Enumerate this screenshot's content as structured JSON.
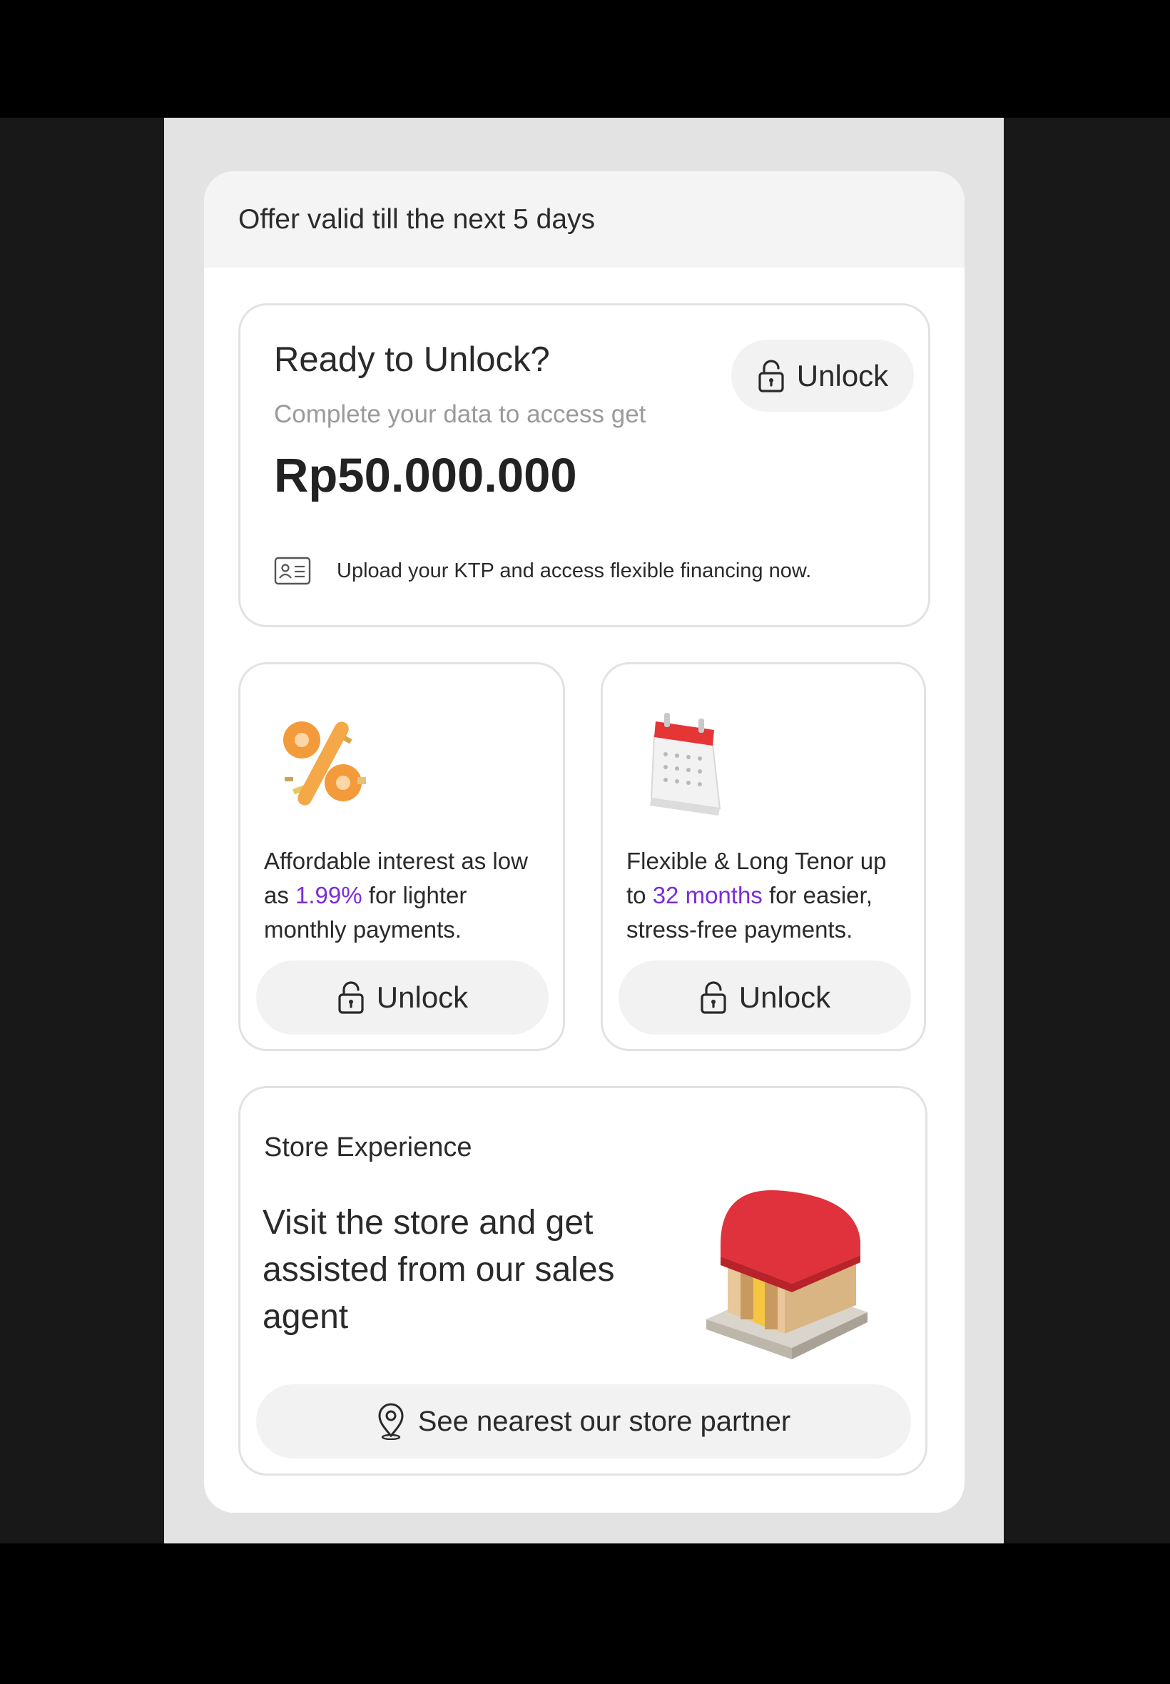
{
  "header": {
    "offer_text": "Offer valid till the next 5 days"
  },
  "unlock_card": {
    "title": "Ready to Unlock?",
    "subtitle": "Complete your data to access get",
    "amount": "Rp50.000.000",
    "button_label": "Unlock",
    "ktp_text": "Upload your KTP and access flexible financing now."
  },
  "features": [
    {
      "text_before": "Affordable interest as low as ",
      "highlight": "1.99%",
      "text_after": " for lighter monthly payments.",
      "button_label": "Unlock",
      "icon": "percent-icon"
    },
    {
      "text_before": "Flexible & Long Tenor up to ",
      "highlight": "32 months",
      "text_after": " for easier, stress-free payments.",
      "button_label": "Unlock",
      "icon": "calendar-icon"
    }
  ],
  "store_card": {
    "label": "Store Experience",
    "headline": "Visit the store and get assisted from our sales agent",
    "button_label": "See nearest our store partner",
    "icon": "store-icon"
  },
  "colors": {
    "accent": "#7a2dd6",
    "button_bg": "#f2f2f2",
    "header_bg": "#f4f4f4"
  }
}
